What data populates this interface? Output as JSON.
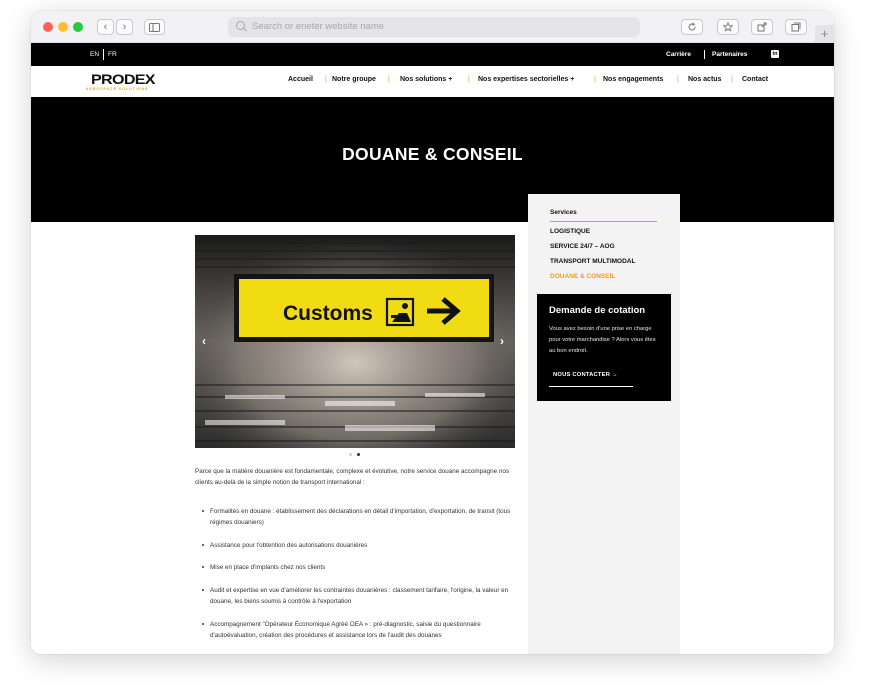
{
  "browser": {
    "address_placeholder": "Search or eneter website name",
    "back_glyph": "‹",
    "forward_glyph": "›",
    "new_tab_glyph": "+",
    "traffic_light_colors": [
      "#fe5f57",
      "#febc2e",
      "#28c840"
    ]
  },
  "topbar": {
    "lang_en": "EN",
    "lang_fr": "FR",
    "careers": "Carrière",
    "partners": "Partenaires",
    "linkedin_glyph": "in"
  },
  "logo": {
    "name": "PRODEX",
    "tagline": "AEROSPACE SOLUTIONS"
  },
  "nav": {
    "items": [
      {
        "label": "Accueil"
      },
      {
        "label": "Notre groupe"
      },
      {
        "label": "Nos solutions +"
      },
      {
        "label": "Nos expertises sectorielles +"
      },
      {
        "label": "Nos engagements"
      },
      {
        "label": "Nos actus"
      },
      {
        "label": "Contact"
      }
    ],
    "separator": "|",
    "accent_color": "#e3a21a"
  },
  "hero": {
    "title": "DOUANE & CONSEIL"
  },
  "sidebar": {
    "heading": "Services",
    "links": [
      {
        "label": "LOGISTIQUE",
        "active": false
      },
      {
        "label": "SERVICE 24/7 – AOG",
        "active": false
      },
      {
        "label": "TRANSPORT MULTIMODAL",
        "active": false
      },
      {
        "label": "DOUANE & CONSEIL",
        "active": true
      }
    ],
    "active_color": "#e3a21a"
  },
  "quote_box": {
    "title": "Demande de cotation",
    "text": "Vous avez besoin d'une prise en charge pour votre marchandise ? Alors vous êtes au bon endroit.",
    "button": "NOUS CONTACTER →"
  },
  "slider": {
    "sign_text": "Customs",
    "prev_glyph": "‹",
    "next_glyph": "›",
    "slide_count": 2,
    "active_slide": 2
  },
  "content": {
    "intro": "Parce que la matière douanière est fondamentale, complexe et évolutive, notre service douane accompagne nos clients au-delà de la simple notion de transport international :",
    "bullets": [
      "Formalités en douane : établissement des déclarations en détail d'importation, d'exportation, de transit (tous régimes douaniers)",
      "Assistance pour l'obtention des autorisations douanières",
      "Mise en place d'implants chez nos clients",
      "Audit et expertise en vue d'améliorer les contraintes douanières : classement tarifaire, l'origine, la valeur en douane, les biens soumis à contrôle à l'exportation",
      "Accompagnement \"Opérateur Économique Agréé OEA » : pré-diagnostic, saisie du questionnaire d'autoévaluation, création des procédures et assistance lors de l'audit des douanes"
    ]
  }
}
